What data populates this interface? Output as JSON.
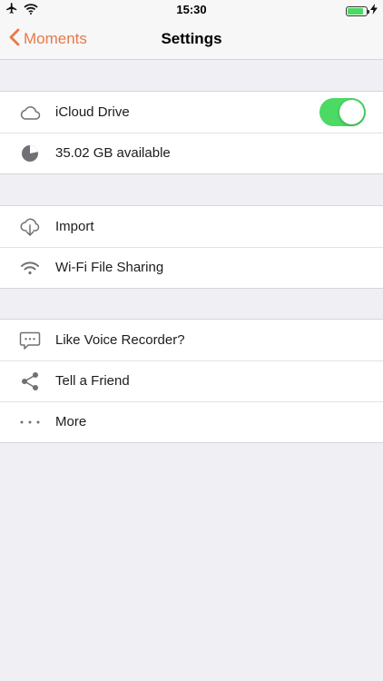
{
  "status_bar": {
    "time": "15:30",
    "battery_level": 0.85
  },
  "navbar": {
    "back_label": "Moments",
    "title": "Settings"
  },
  "groups": {
    "storage": {
      "icloud_label": "iCloud Drive",
      "icloud_enabled": true,
      "space_label": "35.02 GB available"
    },
    "transfer": {
      "import_label": "Import",
      "wifi_label": "Wi-Fi File Sharing"
    },
    "social": {
      "like_label": "Like Voice Recorder?",
      "tell_label": "Tell a Friend",
      "more_label": "More"
    }
  },
  "colors": {
    "accent": "#e8784a",
    "toggle_on": "#4cd964",
    "background": "#efeff4",
    "icon": "#707075"
  }
}
